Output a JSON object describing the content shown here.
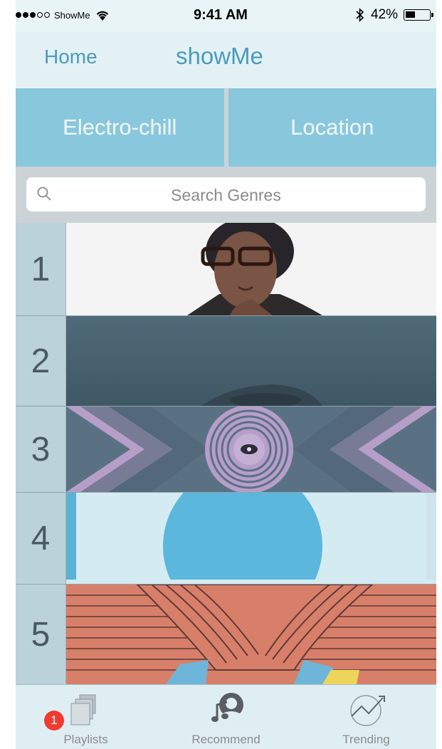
{
  "status_bar": {
    "carrier": "ShowMe",
    "time": "9:41 AM",
    "battery": "42%",
    "battery_level": 0.42
  },
  "nav": {
    "back_label": "Home",
    "title": "showMe"
  },
  "filters": {
    "genre": "Electro-chill",
    "location": "Location"
  },
  "search": {
    "placeholder": "Search Genres"
  },
  "rankings": [
    {
      "rank": "1",
      "icon": "album-art-portrait"
    },
    {
      "rank": "2",
      "icon": "album-art-dark-blue"
    },
    {
      "rank": "3",
      "icon": "album-art-eye-vinyl"
    },
    {
      "rank": "4",
      "icon": "album-art-blue-sphere"
    },
    {
      "rank": "5",
      "icon": "album-art-wavy-lines"
    }
  ],
  "tabs": [
    {
      "label": "Playlists",
      "icon": "playlists-icon",
      "badge": "1"
    },
    {
      "label": "Recommend",
      "icon": "recommend-icon"
    },
    {
      "label": "Trending",
      "icon": "trending-icon"
    }
  ],
  "colors": {
    "accent": "#4a9bbd",
    "segment": "#89c8dc",
    "badge": "#ef3b30"
  }
}
